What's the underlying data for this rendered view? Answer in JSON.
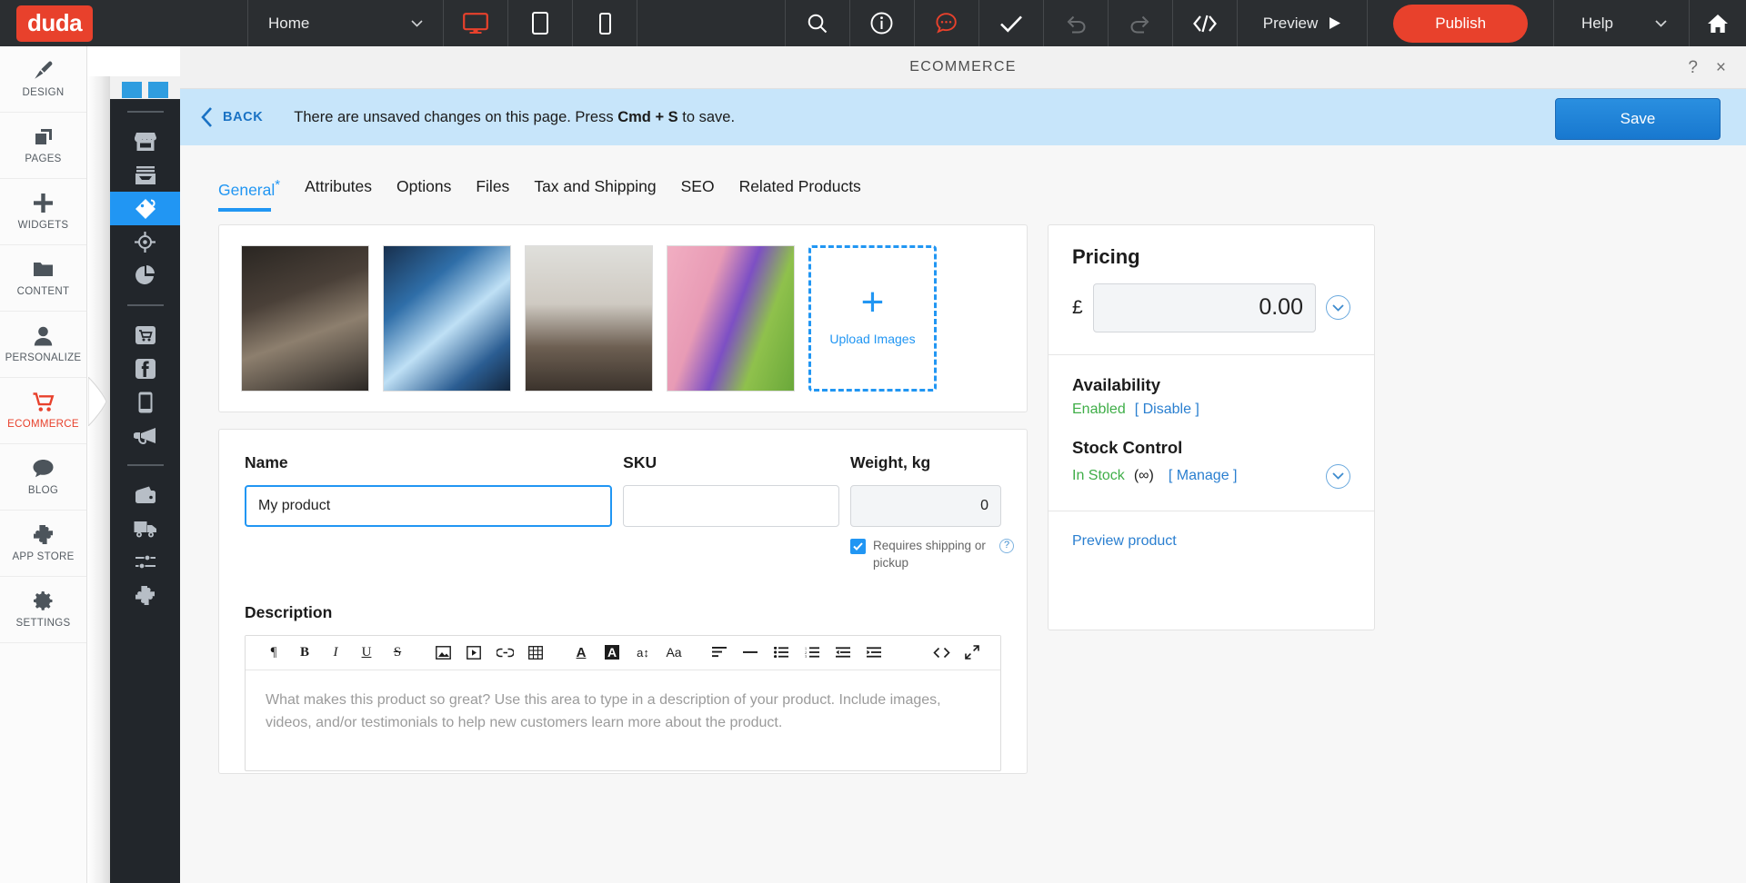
{
  "topbar": {
    "logo": "duda",
    "page_selector": "Home",
    "device_icons": [
      "desktop-icon",
      "tablet-icon",
      "mobile-icon"
    ],
    "tool_icons": [
      "search-icon",
      "info-icon",
      "chat-icon",
      "check-icon",
      "undo-icon",
      "redo-icon",
      "code-icon"
    ],
    "preview_label": "Preview",
    "publish_label": "Publish",
    "help_label": "Help",
    "home_icon": "home-icon",
    "accent_color": "#e8412c",
    "bg_color": "#2b2e31"
  },
  "leftnav": {
    "items": [
      {
        "label": "DESIGN",
        "icon": "brush-icon",
        "active": false
      },
      {
        "label": "PAGES",
        "icon": "pages-icon",
        "active": false
      },
      {
        "label": "WIDGETS",
        "icon": "plus-icon",
        "active": false
      },
      {
        "label": "CONTENT",
        "icon": "folder-icon",
        "active": false
      },
      {
        "label": "PERSONALIZE",
        "icon": "person-icon",
        "active": false
      },
      {
        "label": "ECOMMERCE",
        "icon": "cart-icon",
        "active": true
      },
      {
        "label": "BLOG",
        "icon": "comment-icon",
        "active": false
      },
      {
        "label": "APP STORE",
        "icon": "puzzle-icon",
        "active": false
      },
      {
        "label": "SETTINGS",
        "icon": "gear-icon",
        "active": false
      }
    ]
  },
  "subnav": {
    "groups": [
      [
        "store-icon",
        "inbox-icon",
        "tag-icon",
        "target-icon",
        "pie-chart-icon"
      ],
      [
        "cart-store-icon",
        "facebook-icon",
        "mobile-icon",
        "megaphone-icon"
      ],
      [
        "wallet-icon",
        "truck-icon",
        "sliders-icon",
        "puzzle-icon"
      ]
    ],
    "active_icon": "tag-icon",
    "active_color": "#2196f3"
  },
  "modal": {
    "title": "ECOMMERCE",
    "help_icon": "?",
    "close_icon": "×"
  },
  "notice": {
    "back_label": "BACK",
    "text_before": "There are unsaved changes on this page. Press ",
    "shortcut": "Cmd + S",
    "text_after": " to save.",
    "save_label": "Save",
    "bg_color": "#c7e5fa"
  },
  "tabs": [
    {
      "label": "General",
      "marker": "*",
      "active": true
    },
    {
      "label": "Attributes",
      "marker": "",
      "active": false
    },
    {
      "label": "Options",
      "marker": "",
      "active": false
    },
    {
      "label": "Files",
      "marker": "",
      "active": false
    },
    {
      "label": "Tax and Shipping",
      "marker": "",
      "active": false
    },
    {
      "label": "SEO",
      "marker": "",
      "active": false
    },
    {
      "label": "Related Products",
      "marker": "",
      "active": false
    }
  ],
  "gallery": {
    "thumbnails": [
      {
        "name": "portrait-man-glasses"
      },
      {
        "name": "skyscrapers-looking-up"
      },
      {
        "name": "man-with-phone-cafe"
      },
      {
        "name": "person-holding-yoga-mat"
      }
    ],
    "upload_label": "Upload Images",
    "upload_plus": "+"
  },
  "form": {
    "name_label": "Name",
    "name_value": "My product",
    "sku_label": "SKU",
    "sku_value": "",
    "weight_label": "Weight, kg",
    "weight_value": "0",
    "shipping_checkbox_label": "Requires shipping or pickup",
    "shipping_checked": true,
    "description_label": "Description",
    "description_placeholder": "What makes this product so great? Use this area to type in a description of your product. Include images, videos, and/or testimonials to help new customers learn more about the product."
  },
  "editor_toolbar": {
    "tools": [
      {
        "icon": "paragraph-icon",
        "glyph": "¶"
      },
      {
        "icon": "bold-icon",
        "glyph": "B"
      },
      {
        "icon": "italic-icon",
        "glyph": "I"
      },
      {
        "icon": "underline-icon",
        "glyph": "U"
      },
      {
        "icon": "strikethrough-icon",
        "glyph": "S"
      },
      {
        "icon": "image-icon",
        "glyph": "▣"
      },
      {
        "icon": "video-icon",
        "glyph": "▷"
      },
      {
        "icon": "link-icon",
        "glyph": "⧉"
      },
      {
        "icon": "table-icon",
        "glyph": "☷"
      },
      {
        "icon": "text-color-icon",
        "glyph": "A"
      },
      {
        "icon": "highlight-color-icon",
        "glyph": "A"
      },
      {
        "icon": "font-size-icon",
        "glyph": "a↕"
      },
      {
        "icon": "font-family-icon",
        "glyph": "Aa"
      },
      {
        "icon": "align-icon",
        "glyph": "☰"
      },
      {
        "icon": "horizontal-rule-icon",
        "glyph": "—"
      },
      {
        "icon": "bullet-list-icon",
        "glyph": "☰"
      },
      {
        "icon": "numbered-list-icon",
        "glyph": "☰"
      },
      {
        "icon": "outdent-icon",
        "glyph": "☰"
      },
      {
        "icon": "indent-icon",
        "glyph": "☰"
      },
      {
        "icon": "source-code-icon",
        "glyph": "<>"
      },
      {
        "icon": "fullscreen-icon",
        "glyph": "⤡"
      }
    ]
  },
  "pricing": {
    "title": "Pricing",
    "currency": "£",
    "price": "0.00",
    "expand_icon": "chevron-down-icon",
    "availability_label": "Availability",
    "availability_status": "Enabled",
    "availability_action": "[ Disable ]",
    "stock_label": "Stock Control",
    "stock_status": "In Stock",
    "stock_qty": "(∞)",
    "stock_action": "[ Manage ]",
    "preview_product": "Preview product",
    "status_green": "#3fae48",
    "link_blue": "#2a7fd0"
  }
}
